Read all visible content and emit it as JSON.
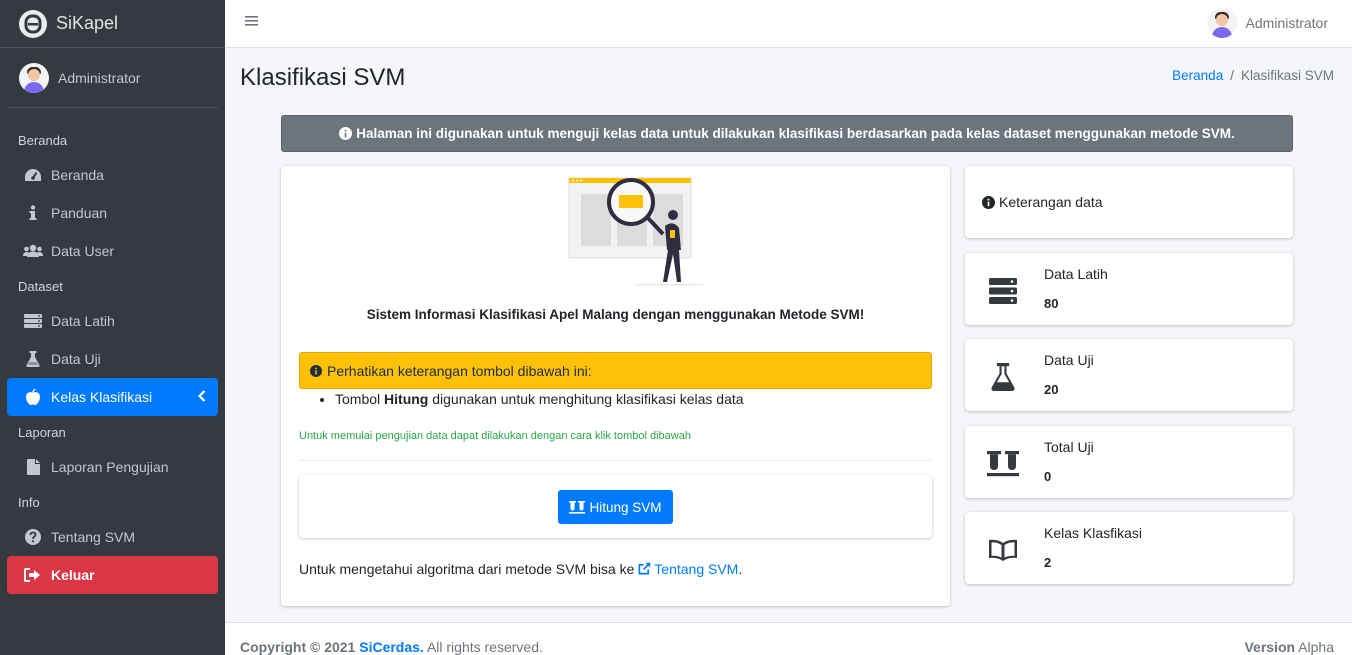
{
  "brand": {
    "name": "SiKapel"
  },
  "sidebar": {
    "user": "Administrator",
    "sections": [
      {
        "header": "Beranda",
        "items": [
          {
            "label": "Beranda",
            "icon": "tachometer-icon"
          },
          {
            "label": "Panduan",
            "icon": "info-icon"
          },
          {
            "label": "Data User",
            "icon": "users-icon"
          }
        ]
      },
      {
        "header": "Dataset",
        "items": [
          {
            "label": "Data Latih",
            "icon": "server-icon"
          },
          {
            "label": "Data Uji",
            "icon": "flask-icon"
          },
          {
            "label": "Kelas Klasifikasi",
            "icon": "apple-icon",
            "active": true
          }
        ]
      },
      {
        "header": "Laporan",
        "items": [
          {
            "label": "Laporan Pengujian",
            "icon": "file-icon"
          }
        ]
      },
      {
        "header": "Info",
        "items": [
          {
            "label": "Tentang SVM",
            "icon": "question-circle-icon"
          },
          {
            "label": "Keluar",
            "icon": "sign-out-icon",
            "danger": true
          }
        ]
      }
    ]
  },
  "topbar": {
    "user": "Administrator"
  },
  "page": {
    "title": "Klasifikasi SVM",
    "breadcrumb": {
      "home": "Beranda",
      "sep": "/",
      "current": "Klasifikasi SVM"
    }
  },
  "info_bar": "Halaman ini digunakan untuk menguji kelas data untuk dilakukan klasifikasi berdasarkan pada kelas dataset menggunakan metode SVM.",
  "main": {
    "heading": "Sistem Informasi Klasifikasi Apel Malang dengan menggunakan Metode SVM!",
    "warning": "Perhatikan keterangan tombol dibawah ini:",
    "bullet_prefix": "Tombol ",
    "bullet_bold": "Hitung",
    "bullet_suffix": " digunakan untuk menghitung klasifikasi kelas data",
    "note": "Untuk memulai pengujian data dapat dilakukan dengan cara klik tombol dibawah",
    "button": "Hitung SVM",
    "footer_text": "Untuk mengetahui algoritma dari metode SVM bisa ke ",
    "footer_link": "Tentang SVM",
    "footer_end": "."
  },
  "side": {
    "info_title": "Keterangan data",
    "stats": [
      {
        "label": "Data Latih",
        "value": "80",
        "icon": "server-icon"
      },
      {
        "label": "Data Uji",
        "value": "20",
        "icon": "flask-icon"
      },
      {
        "label": "Total Uji",
        "value": "0",
        "icon": "vials-icon"
      },
      {
        "label": "Kelas Klasfikasi",
        "value": "2",
        "icon": "book-open-icon"
      }
    ]
  },
  "footer": {
    "copyright": "Copyright © 2021 ",
    "brand": "SiCerdas.",
    "rights": " All rights reserved.",
    "version_label": "Version",
    "version": " Alpha"
  },
  "colors": {
    "primary": "#007bff",
    "danger": "#dc3545",
    "warning": "#ffc107",
    "secondary": "#6c757d",
    "sidebar": "#343a40"
  }
}
